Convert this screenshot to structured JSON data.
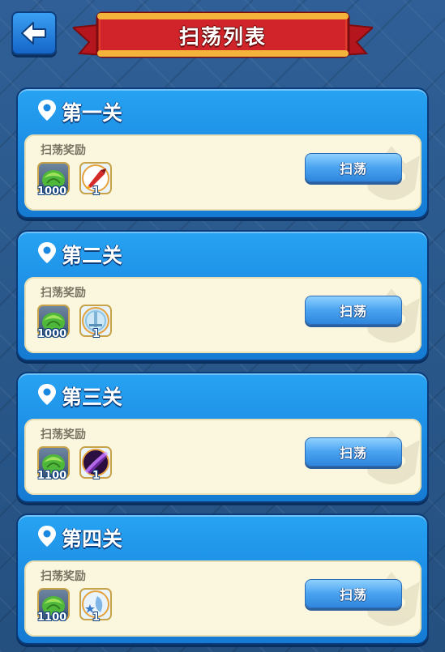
{
  "header": {
    "title": "扫荡列表",
    "back_icon": "arrow-left-icon"
  },
  "levels": [
    {
      "name": "第一关",
      "reward_label": "扫荡奖励",
      "button_label": "扫荡",
      "rewards": [
        {
          "icon": "gold-leaf-icon",
          "count": "1000"
        },
        {
          "icon": "red-rocket-icon",
          "count": "1"
        }
      ]
    },
    {
      "name": "第二关",
      "reward_label": "扫荡奖励",
      "button_label": "扫荡",
      "rewards": [
        {
          "icon": "gold-leaf-icon",
          "count": "1000"
        },
        {
          "icon": "blue-sword-icon",
          "count": "1"
        }
      ]
    },
    {
      "name": "第三关",
      "reward_label": "扫荡奖励",
      "button_label": "扫荡",
      "rewards": [
        {
          "icon": "gold-leaf-icon",
          "count": "1100"
        },
        {
          "icon": "purple-slash-icon",
          "count": "1"
        }
      ]
    },
    {
      "name": "第四关",
      "reward_label": "扫荡奖励",
      "button_label": "扫荡",
      "rewards": [
        {
          "icon": "gold-leaf-icon",
          "count": "1100"
        },
        {
          "icon": "blue-star-orb-icon",
          "count": "1"
        }
      ]
    }
  ],
  "colors": {
    "banner_red": "#d8232a",
    "card_blue": "#1a88e0",
    "card_body": "#fbf7df",
    "button_blue": "#4aa3f0"
  }
}
